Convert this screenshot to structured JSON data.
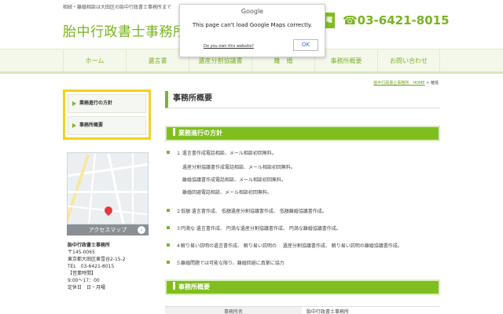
{
  "header": {
    "tagline": "相続・離婚相談は大田区の胎中行政書士事務所まで",
    "title": "胎中行政書士事務所",
    "phone_tag": "日曜",
    "phone": "☎03-6421-8015"
  },
  "nav": {
    "items": [
      {
        "label": "ホーム"
      },
      {
        "label": "遺言書"
      },
      {
        "label": "遺産分割協議書"
      },
      {
        "label": "離　婚"
      },
      {
        "label": "事務所概要"
      },
      {
        "label": "お問い合わせ"
      }
    ]
  },
  "breadcrumb": {
    "home": "胎中行政書士事務所　HOME",
    "sep": ">",
    "current": "離婚"
  },
  "sidebar": {
    "items": [
      {
        "label": "業務進行の方針"
      },
      {
        "label": "事務所概要"
      }
    ],
    "map_button": "アクセスマップ",
    "info": {
      "name": "胎中行政書士事務所",
      "zip": "〒145-0065",
      "address": "東京都大田区東雪谷2-15-2",
      "tel": "TEL　03-6421-8015",
      "hours_label": "【営業時間】",
      "hours": "9:00～17：00",
      "closed": "定休日　日・月曜"
    }
  },
  "main": {
    "page_title": "事務所概要",
    "section1_title": "業務進行の方針",
    "list": [
      "１ 遺言書作成電話相談、メール相談初回無料。",
      "２低額 遺言書作成、 低額遺産分割協議書作成、 低額離婚協議書作成。",
      "３円満な 遺言書作成、 円満な遺産分割協議書作成、 円満な離婚協議書作成。",
      "４解り易い説明の遺言書作成、 解り易い説明の 　遺産分割協議書作成、 解り易い説明の離婚協議書作成。",
      "５離婚問題では可能な限り、離婚回避に真摯に協力"
    ],
    "sublist": [
      "遺産分割協議書作成電話相談、メール相談初回無料。",
      "離婚協議書作成電話相談、メール相談初回無料。",
      "離婚回避電話相談、メール相談初回無料。"
    ],
    "section2_title": "事務所概要",
    "table_label": "事務所名",
    "table_value": "胎中行政書士事務所"
  },
  "dialog": {
    "brand": "Google",
    "message": "This page can't load Google Maps correctly.",
    "link": "Do you own this website?",
    "ok": "OK"
  }
}
